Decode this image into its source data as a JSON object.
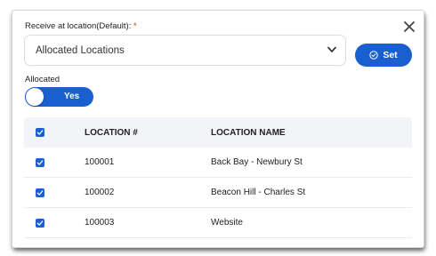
{
  "receive": {
    "label": "Receive at location(Default):",
    "required_mark": "*",
    "selected": "Allocated Locations",
    "set_label": "Set"
  },
  "allocated": {
    "label": "Allocated",
    "toggle_text": "Yes",
    "on": true
  },
  "table": {
    "headers": [
      "LOCATION #",
      "LOCATION NAME"
    ],
    "all_checked": true,
    "rows": [
      {
        "checked": true,
        "number": "100001",
        "name": "Back Bay - Newbury St"
      },
      {
        "checked": true,
        "number": "100002",
        "name": "Beacon Hill - Charles St"
      },
      {
        "checked": true,
        "number": "100003",
        "name": "Website"
      }
    ]
  },
  "colors": {
    "accent": "#1a5fd0",
    "required": "#d93025",
    "header_bg": "#f2f4f7"
  },
  "icons": {
    "close": "close-icon",
    "dropdown": "chevron-down-icon",
    "set": "check-circle-icon",
    "checkbox": "checkmark-icon"
  }
}
